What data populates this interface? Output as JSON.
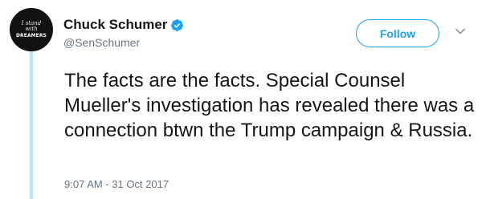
{
  "user": {
    "display_name": "Chuck Schumer",
    "handle": "@SenSchumer",
    "verified": true,
    "avatar_text": [
      "I stand",
      "with",
      "DREAMERS"
    ]
  },
  "actions": {
    "follow_label": "Follow",
    "more_icon": "chevron-down-icon"
  },
  "tweet": {
    "text": "The facts are the facts. Special Counsel Mueller's investigation has revealed there was a connection btwn the Trump campaign & Russia.",
    "timestamp": "9:07 AM - 31 Oct 2017"
  },
  "colors": {
    "accent": "#1da1f2",
    "thread_line": "#b7e6f7",
    "secondary_text": "#657786",
    "primary_text": "#14171a"
  }
}
